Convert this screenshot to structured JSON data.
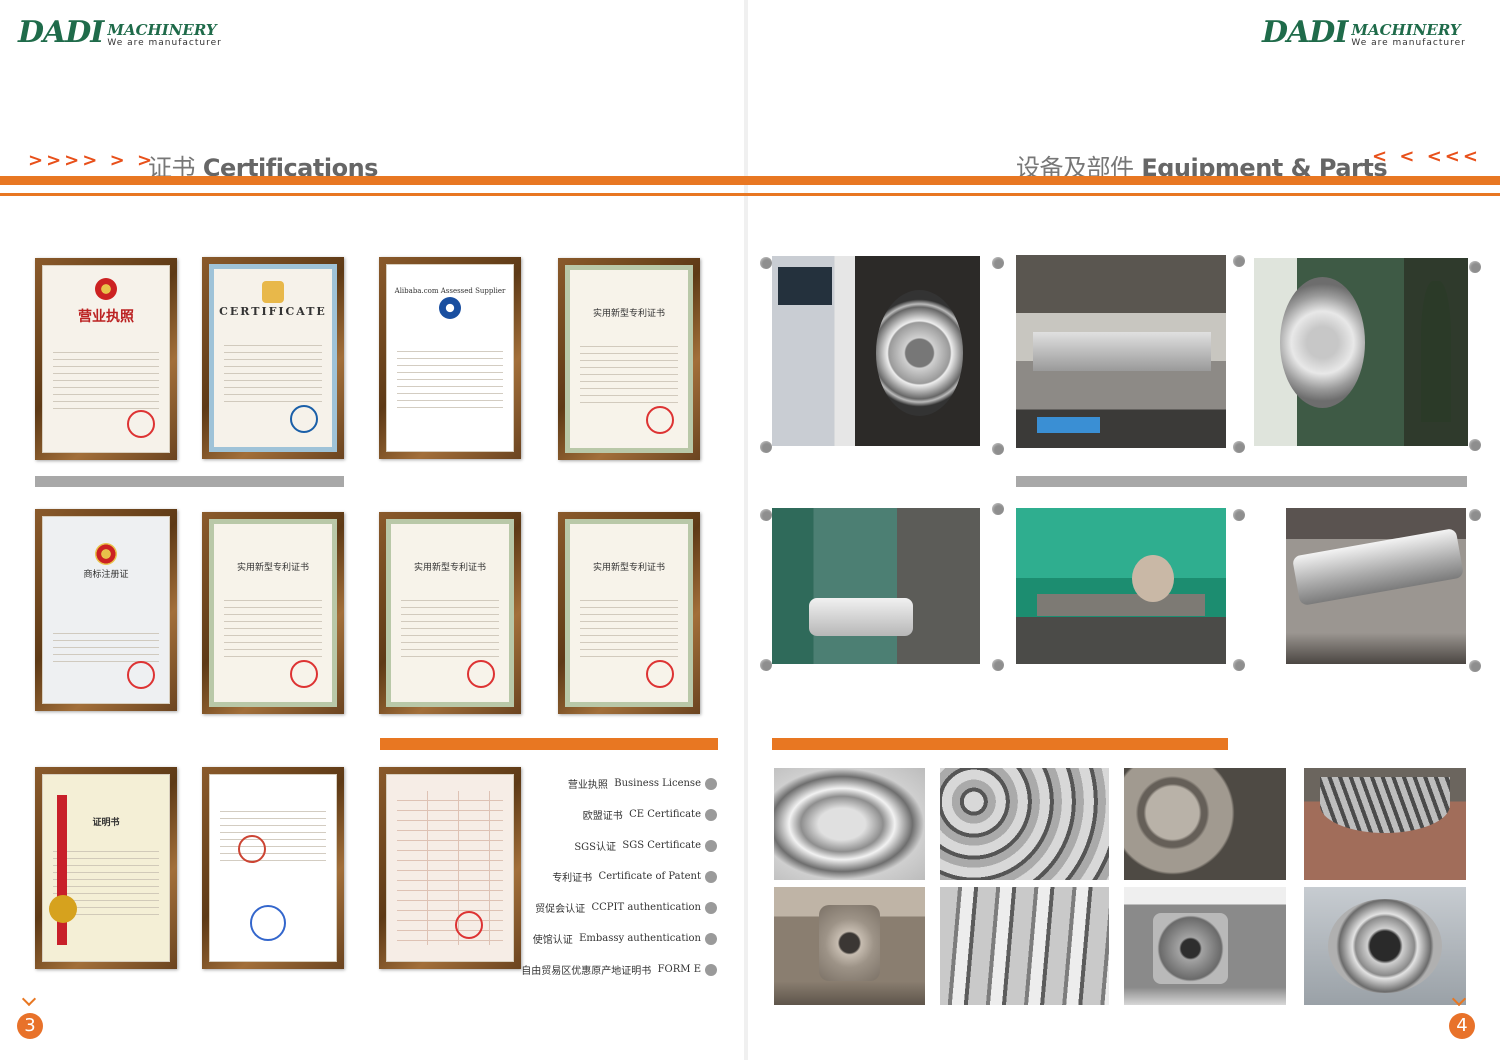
{
  "brand": {
    "mark": "DADI",
    "name": "MACHINERY",
    "tagline": "We are manufacturer"
  },
  "left_page": {
    "heading_cn": "证书",
    "heading_en": "Certifications",
    "arrows": ">>>> > >",
    "page_number": "3",
    "certificates": [
      {
        "name": "business-license",
        "title": "营业执照"
      },
      {
        "name": "ce-certificate",
        "title": "CERTIFICATE"
      },
      {
        "name": "sgs-assessed",
        "title": "Alibaba.com Assessed Supplier"
      },
      {
        "name": "patent-1",
        "title": "实用新型专利证书"
      },
      {
        "name": "trademark",
        "title": "商标注册证"
      },
      {
        "name": "patent-2",
        "title": "实用新型专利证书"
      },
      {
        "name": "patent-3",
        "title": "实用新型专利证书"
      },
      {
        "name": "patent-4",
        "title": "实用新型专利证书"
      },
      {
        "name": "ccpit",
        "title": "证明书"
      },
      {
        "name": "embassy",
        "title": ""
      },
      {
        "name": "form-e",
        "title": ""
      }
    ],
    "legend": [
      {
        "cn": "营业执照",
        "en": "Business License"
      },
      {
        "cn": "欧盟证书",
        "en": "CE Certificate"
      },
      {
        "cn": "SGS认证",
        "en": "SGS Certificate"
      },
      {
        "cn": "专利证书",
        "en": "Certificate of Patent"
      },
      {
        "cn": "贸促会认证",
        "en": "CCPIT authentication"
      },
      {
        "cn": "使馆认证",
        "en": "Embassy authentication"
      },
      {
        "cn": "自由贸易区优惠原产地证明书",
        "en": "FORM E"
      }
    ]
  },
  "right_page": {
    "heading_cn": "设备及部件",
    "heading_en": "Equipment & Parts",
    "arrows": "< < <<<",
    "page_number": "4",
    "equipment_photos": [
      "cnc-machine",
      "lathe",
      "worker-lathe",
      "vertical-lathe",
      "milling-machine",
      "shaft-turning"
    ],
    "parts_photos": [
      "steel-rings",
      "sleeves",
      "wheels",
      "bevel-gear",
      "bearing-housing",
      "shafts",
      "gearbox",
      "bearing"
    ]
  },
  "colors": {
    "accent": "#e87722",
    "brand_green": "#1f6b4a",
    "frame_brown": "#6b4420",
    "pin_gray": "#8e8e8e"
  }
}
